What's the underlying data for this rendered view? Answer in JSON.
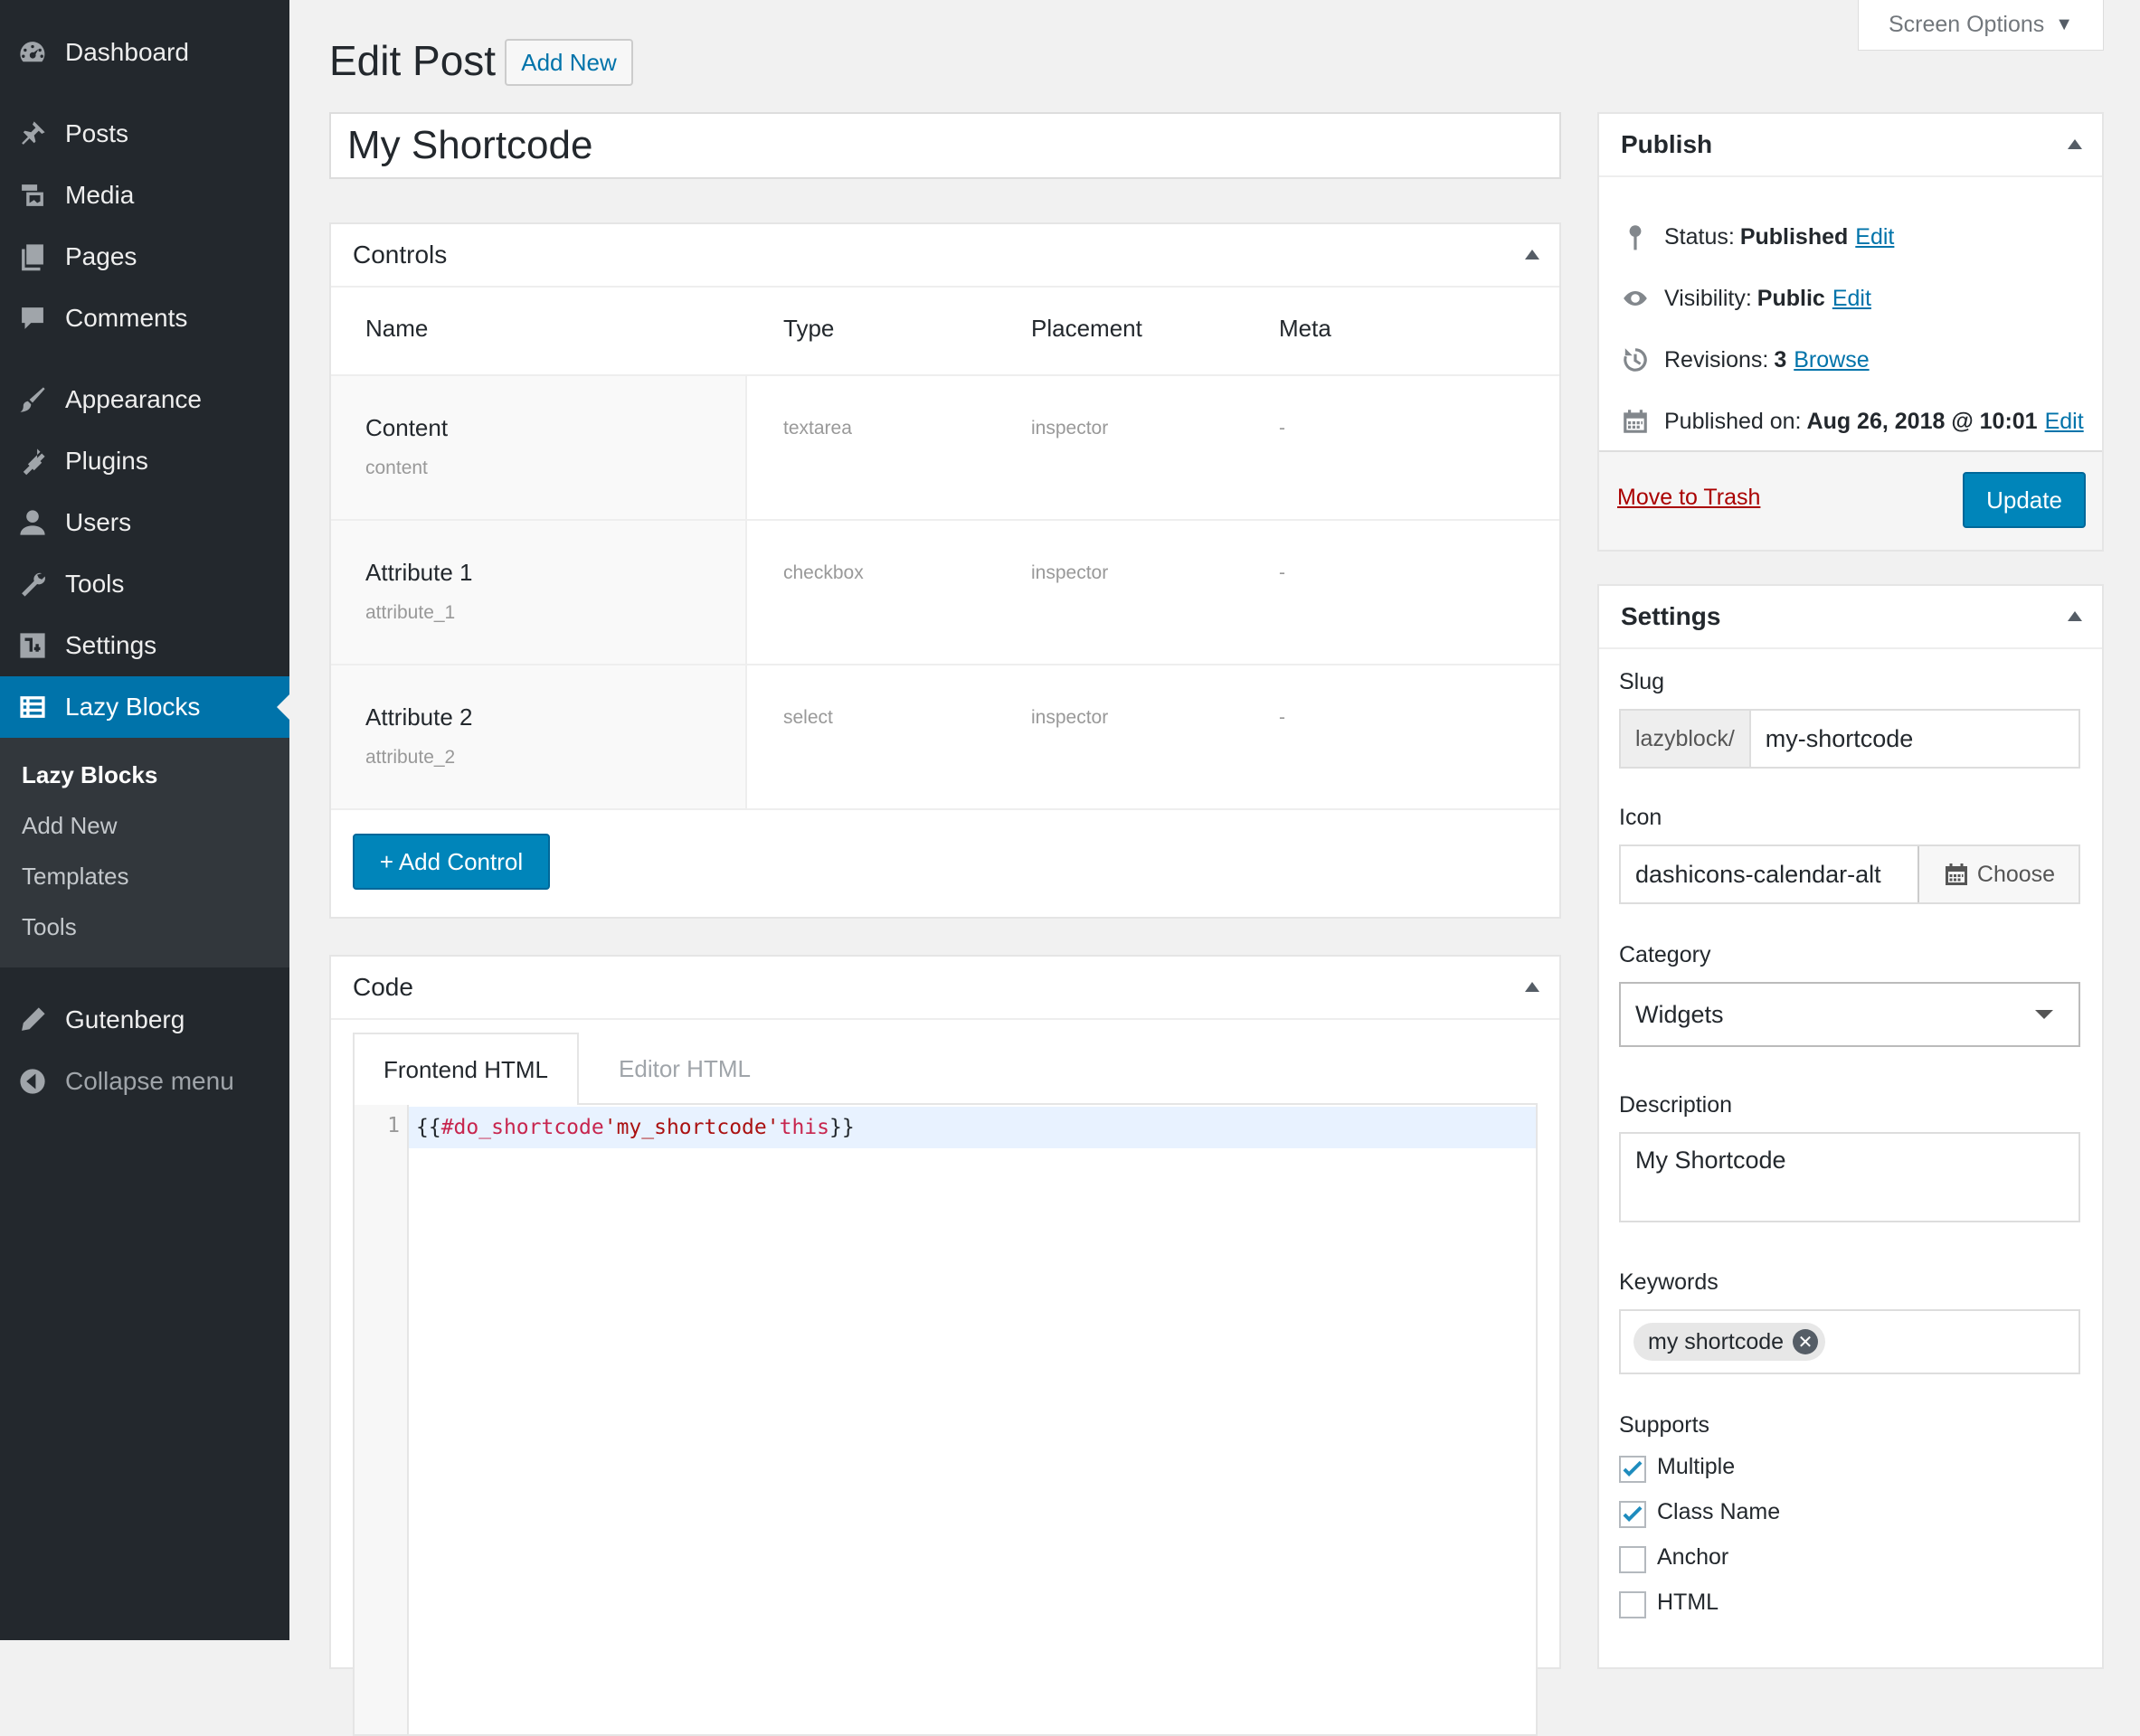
{
  "sidebar": {
    "items": [
      {
        "label": "Dashboard",
        "icon": "dashboard-icon"
      },
      {
        "label": "Posts",
        "icon": "pin-icon"
      },
      {
        "label": "Media",
        "icon": "media-icon"
      },
      {
        "label": "Pages",
        "icon": "pages-icon"
      },
      {
        "label": "Comments",
        "icon": "comment-icon"
      },
      {
        "label": "Appearance",
        "icon": "paintbrush-icon"
      },
      {
        "label": "Plugins",
        "icon": "plugin-icon"
      },
      {
        "label": "Users",
        "icon": "user-icon"
      },
      {
        "label": "Tools",
        "icon": "wrench-icon"
      },
      {
        "label": "Settings",
        "icon": "settings-icon"
      },
      {
        "label": "Lazy Blocks",
        "icon": "table-icon"
      },
      {
        "label": "Gutenberg",
        "icon": "pencil-icon"
      },
      {
        "label": "Collapse menu",
        "icon": "collapse-icon"
      }
    ],
    "submenu": [
      "Lazy Blocks",
      "Add New",
      "Templates",
      "Tools"
    ]
  },
  "header": {
    "screen_options": "Screen Options",
    "title": "Edit Post",
    "add_new": "Add New",
    "post_title": "My Shortcode"
  },
  "controls": {
    "title": "Controls",
    "columns": [
      "Name",
      "Type",
      "Placement",
      "Meta"
    ],
    "rows": [
      {
        "label": "Content",
        "slug": "content",
        "type": "textarea",
        "placement": "inspector",
        "meta": "-"
      },
      {
        "label": "Attribute 1",
        "slug": "attribute_1",
        "type": "checkbox",
        "placement": "inspector",
        "meta": "-"
      },
      {
        "label": "Attribute 2",
        "slug": "attribute_2",
        "type": "select",
        "placement": "inspector",
        "meta": "-"
      }
    ],
    "add_button": "+ Add Control"
  },
  "code": {
    "title": "Code",
    "tabs": [
      "Frontend HTML",
      "Editor HTML"
    ],
    "line_number": "1",
    "tokens": {
      "open": "{{",
      "helper": "#do_shortcode",
      "arg": "'my_shortcode'",
      "ctx": "this",
      "close": "}}"
    }
  },
  "publish": {
    "title": "Publish",
    "status_label": "Status:",
    "status_value": "Published",
    "visibility_label": "Visibility:",
    "visibility_value": "Public",
    "revisions_label": "Revisions:",
    "revisions_value": "3",
    "published_label": "Published on:",
    "published_value": "Aug 26, 2018 @ 10:01",
    "edit": "Edit",
    "browse": "Browse",
    "trash": "Move to Trash",
    "update": "Update"
  },
  "settings": {
    "title": "Settings",
    "slug_label": "Slug",
    "slug_prefix": "lazyblock/",
    "slug_value": "my-shortcode",
    "icon_label": "Icon",
    "icon_value": "dashicons-calendar-alt",
    "choose": "Choose",
    "category_label": "Category",
    "category_value": "Widgets",
    "description_label": "Description",
    "description_value": "My Shortcode",
    "keywords_label": "Keywords",
    "keyword_tag": "my shortcode",
    "supports_label": "Supports",
    "supports": [
      {
        "label": "Multiple",
        "checked": true
      },
      {
        "label": "Class Name",
        "checked": true
      },
      {
        "label": "Anchor",
        "checked": false
      },
      {
        "label": "HTML",
        "checked": false
      }
    ]
  },
  "colors": {
    "sidebar_bg": "#23282d",
    "accent": "#0073aa",
    "button_primary": "#0085ba",
    "trash": "#a00"
  }
}
